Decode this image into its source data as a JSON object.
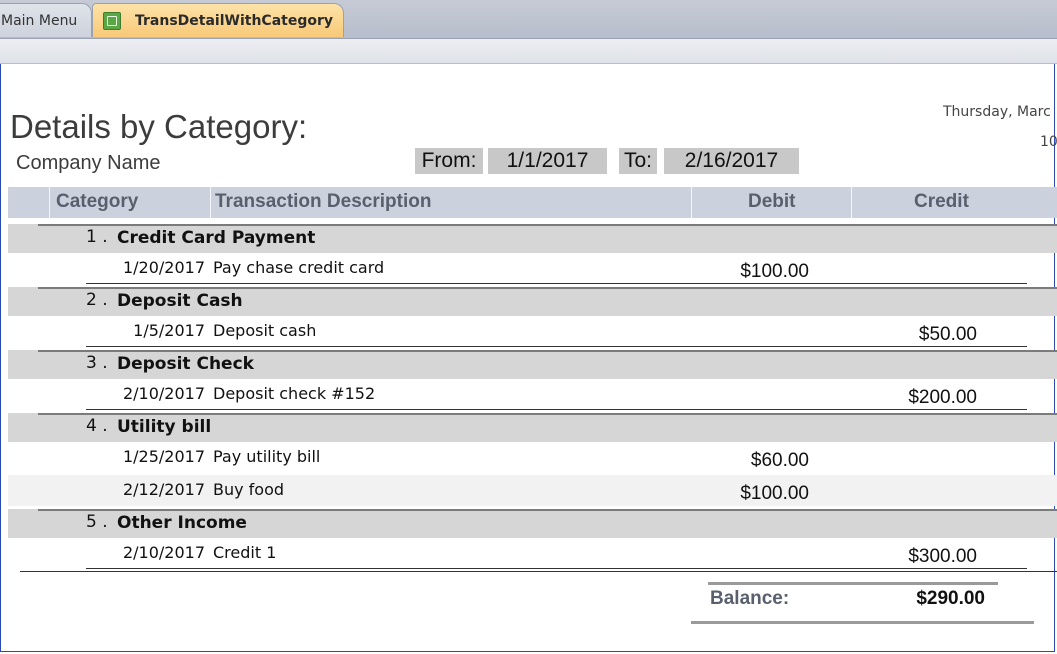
{
  "tabs": [
    {
      "label": "Main Menu",
      "active": false
    },
    {
      "label": "TransDetailWithCategory",
      "active": true,
      "icon": "report-icon"
    }
  ],
  "report": {
    "title": "Details by Category:",
    "company": "Company Name",
    "date_text": "Thursday, Marc",
    "time_text": "10",
    "from_label": "From:",
    "from_value": "1/1/2017",
    "to_label": "To:",
    "to_value": "2/16/2017"
  },
  "columns": {
    "category": "Category",
    "description": "Transaction Description",
    "debit": "Debit",
    "credit": "Credit"
  },
  "groups": [
    {
      "num": "1 .",
      "name": "Credit Card Payment",
      "rows": [
        {
          "date": "1/20/2017",
          "desc": "Pay chase credit card",
          "debit": "$100.00",
          "credit": ""
        }
      ]
    },
    {
      "num": "2 .",
      "name": "Deposit Cash",
      "rows": [
        {
          "date": "1/5/2017",
          "desc": "Deposit cash",
          "debit": "",
          "credit": "$50.00"
        }
      ]
    },
    {
      "num": "3 .",
      "name": "Deposit Check",
      "rows": [
        {
          "date": "2/10/2017",
          "desc": "Deposit check #152",
          "debit": "",
          "credit": "$200.00"
        }
      ]
    },
    {
      "num": "4 .",
      "name": "Utility bill",
      "rows": [
        {
          "date": "1/25/2017",
          "desc": "Pay utility bill",
          "debit": "$60.00",
          "credit": ""
        },
        {
          "date": "2/12/2017",
          "desc": "Buy food",
          "debit": "$100.00",
          "credit": ""
        }
      ]
    },
    {
      "num": "5 .",
      "name": "Other Income",
      "rows": [
        {
          "date": "2/10/2017",
          "desc": "Credit 1",
          "debit": "",
          "credit": "$300.00"
        }
      ]
    }
  ],
  "balance": {
    "label": "Balance:",
    "value": "$290.00"
  },
  "colors": {
    "active_tab": "#f8c978",
    "header_band": "#ccd2dd",
    "category_band": "#d6d6d6",
    "frame": "#2a4ab7"
  }
}
